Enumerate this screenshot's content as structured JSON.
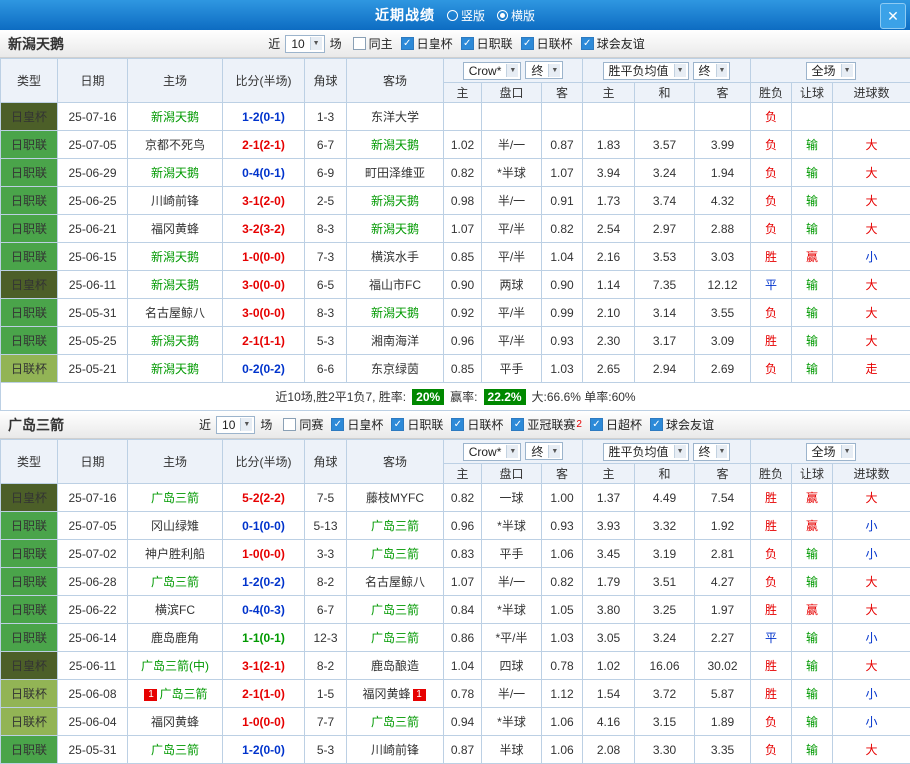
{
  "topbar": {
    "title": "近期战绩",
    "radio_vertical": "竖版",
    "radio_horizontal": "横版",
    "selected_layout": "横版"
  },
  "icons": {
    "dropdown_arrow": "▼",
    "check": "✓",
    "close": "✕"
  },
  "colors": {
    "type_bg": {
      "日皇杯": "#4c5f28",
      "日职联": "#4aa44a",
      "日联杯": "#92b455"
    },
    "score": {
      "home_win": "#e60000",
      "draw": "#009900",
      "away_win": "#0033cc"
    },
    "result": {
      "胜": "#e60000",
      "平": "#0033cc",
      "负": "#e60000",
      "赢": "#e60000",
      "输": "#009900",
      "大": "#e60000",
      "小": "#0033cc",
      "走": "#e60000"
    },
    "focus_team": "#009900",
    "odds_text": "#2b4b9e",
    "summary_badge_bg": "#008800"
  },
  "table_header": {
    "main_cols": [
      "类型",
      "日期",
      "主场",
      "比分(半场)",
      "角球",
      "客场"
    ],
    "group1": {
      "selects": [
        "Crow*",
        "终"
      ],
      "cols": [
        "主",
        "盘口",
        "客"
      ]
    },
    "group2": {
      "selects": [
        "胜平负均值",
        "终"
      ],
      "cols": [
        "主",
        "和",
        "客"
      ]
    },
    "group3": {
      "selects": [
        "全场"
      ],
      "cols": [
        "胜负",
        "让球",
        "进球数"
      ]
    }
  },
  "sections": [
    {
      "team": "新潟天鹅",
      "filter": {
        "prefix": "近",
        "count": "10",
        "suffix": "场",
        "checkboxes": [
          {
            "label": "同主",
            "checked": false
          },
          {
            "label": "日皇杯",
            "checked": true
          },
          {
            "label": "日职联",
            "checked": true
          },
          {
            "label": "日联杯",
            "checked": true
          },
          {
            "label": "球会友谊",
            "checked": true
          }
        ]
      },
      "rows": [
        {
          "type": "日皇杯",
          "date": "25-07-16",
          "home": "新潟天鹅",
          "hf": true,
          "hb": "",
          "score": "1-2(0-1)",
          "sr": "away_win",
          "corner": "1-3",
          "away": "东洋大学",
          "af": false,
          "ab": "",
          "crown": [
            "",
            "",
            ""
          ],
          "avg": [
            "",
            "",
            ""
          ],
          "outcome": [
            "负",
            "",
            ""
          ]
        },
        {
          "type": "日职联",
          "date": "25-07-05",
          "home": "京都不死鸟",
          "hf": false,
          "hb": "",
          "score": "2-1(2-1)",
          "sr": "home_win",
          "corner": "6-7",
          "away": "新潟天鹅",
          "af": true,
          "ab": "",
          "crown": [
            "1.02",
            "半/一",
            "0.87"
          ],
          "avg": [
            "1.83",
            "3.57",
            "3.99"
          ],
          "outcome": [
            "负",
            "输",
            "大"
          ]
        },
        {
          "type": "日职联",
          "date": "25-06-29",
          "home": "新潟天鹅",
          "hf": true,
          "hb": "",
          "score": "0-4(0-1)",
          "sr": "away_win",
          "corner": "6-9",
          "away": "町田泽维亚",
          "af": false,
          "ab": "",
          "crown": [
            "0.82",
            "*半球",
            "1.07"
          ],
          "avg": [
            "3.94",
            "3.24",
            "1.94"
          ],
          "outcome": [
            "负",
            "输",
            "大"
          ]
        },
        {
          "type": "日职联",
          "date": "25-06-25",
          "home": "川崎前锋",
          "hf": false,
          "hb": "",
          "score": "3-1(2-0)",
          "sr": "home_win",
          "corner": "2-5",
          "away": "新潟天鹅",
          "af": true,
          "ab": "",
          "crown": [
            "0.98",
            "半/一",
            "0.91"
          ],
          "avg": [
            "1.73",
            "3.74",
            "4.32"
          ],
          "outcome": [
            "负",
            "输",
            "大"
          ]
        },
        {
          "type": "日职联",
          "date": "25-06-21",
          "home": "福冈黄蜂",
          "hf": false,
          "hb": "",
          "score": "3-2(3-2)",
          "sr": "home_win",
          "corner": "8-3",
          "away": "新潟天鹅",
          "af": true,
          "ab": "",
          "crown": [
            "1.07",
            "平/半",
            "0.82"
          ],
          "avg": [
            "2.54",
            "2.97",
            "2.88"
          ],
          "outcome": [
            "负",
            "输",
            "大"
          ]
        },
        {
          "type": "日职联",
          "date": "25-06-15",
          "home": "新潟天鹅",
          "hf": true,
          "hb": "",
          "score": "1-0(0-0)",
          "sr": "home_win",
          "corner": "7-3",
          "away": "横滨水手",
          "af": false,
          "ab": "",
          "crown": [
            "0.85",
            "平/半",
            "1.04"
          ],
          "avg": [
            "2.16",
            "3.53",
            "3.03"
          ],
          "outcome": [
            "胜",
            "赢",
            "小"
          ]
        },
        {
          "type": "日皇杯",
          "date": "25-06-11",
          "home": "新潟天鹅",
          "hf": true,
          "hb": "",
          "score": "3-0(0-0)",
          "sr": "home_win",
          "corner": "6-5",
          "away": "福山市FC",
          "af": false,
          "ab": "",
          "crown": [
            "0.90",
            "两球",
            "0.90"
          ],
          "avg": [
            "1.14",
            "7.35",
            "12.12"
          ],
          "outcome": [
            "平",
            "输",
            "大"
          ]
        },
        {
          "type": "日职联",
          "date": "25-05-31",
          "home": "名古屋鲸八",
          "hf": false,
          "hb": "",
          "score": "3-0(0-0)",
          "sr": "home_win",
          "corner": "8-3",
          "away": "新潟天鹅",
          "af": true,
          "ab": "",
          "crown": [
            "0.92",
            "平/半",
            "0.99"
          ],
          "avg": [
            "2.10",
            "3.14",
            "3.55"
          ],
          "outcome": [
            "负",
            "输",
            "大"
          ]
        },
        {
          "type": "日职联",
          "date": "25-05-25",
          "home": "新潟天鹅",
          "hf": true,
          "hb": "",
          "score": "2-1(1-1)",
          "sr": "home_win",
          "corner": "5-3",
          "away": "湘南海洋",
          "af": false,
          "ab": "",
          "crown": [
            "0.96",
            "平/半",
            "0.93"
          ],
          "avg": [
            "2.30",
            "3.17",
            "3.09"
          ],
          "outcome": [
            "胜",
            "输",
            "大"
          ]
        },
        {
          "type": "日联杯",
          "date": "25-05-21",
          "home": "新潟天鹅",
          "hf": true,
          "hb": "",
          "score": "0-2(0-2)",
          "sr": "away_win",
          "corner": "6-6",
          "away": "东京绿茵",
          "af": false,
          "ab": "",
          "crown": [
            "0.85",
            "平手",
            "1.03"
          ],
          "avg": [
            "2.65",
            "2.94",
            "2.69"
          ],
          "outcome": [
            "负",
            "输",
            "走"
          ]
        }
      ],
      "summary": [
        {
          "text": "近10场,胜2平1负7, 胜率:",
          "badge": false
        },
        {
          "text": "20%",
          "badge": true
        },
        {
          "text": "赢率:",
          "badge": false
        },
        {
          "text": "22.2%",
          "badge": true
        },
        {
          "text": "大:66.6% 单率:60%",
          "badge": false
        }
      ]
    },
    {
      "team": "广岛三箭",
      "filter": {
        "prefix": "近",
        "count": "10",
        "suffix": "场",
        "checkboxes": [
          {
            "label": "同赛",
            "checked": false
          },
          {
            "label": "日皇杯",
            "checked": true
          },
          {
            "label": "日职联",
            "checked": true
          },
          {
            "label": "日联杯",
            "checked": true
          },
          {
            "label": "亚冠联赛",
            "checked": true,
            "badge": "2"
          },
          {
            "label": "日超杯",
            "checked": true
          },
          {
            "label": "球会友谊",
            "checked": true
          }
        ]
      },
      "rows": [
        {
          "type": "日皇杯",
          "date": "25-07-16",
          "home": "广岛三箭",
          "hf": true,
          "hb": "",
          "score": "5-2(2-2)",
          "sr": "home_win",
          "corner": "7-5",
          "away": "藤枝MYFC",
          "af": false,
          "ab": "",
          "crown": [
            "0.82",
            "一球",
            "1.00"
          ],
          "avg": [
            "1.37",
            "4.49",
            "7.54"
          ],
          "outcome": [
            "胜",
            "赢",
            "大"
          ]
        },
        {
          "type": "日职联",
          "date": "25-07-05",
          "home": "冈山绿雉",
          "hf": false,
          "hb": "",
          "score": "0-1(0-0)",
          "sr": "away_win",
          "corner": "5-13",
          "away": "广岛三箭",
          "af": true,
          "ab": "",
          "crown": [
            "0.96",
            "*半球",
            "0.93"
          ],
          "avg": [
            "3.93",
            "3.32",
            "1.92"
          ],
          "outcome": [
            "胜",
            "赢",
            "小"
          ]
        },
        {
          "type": "日职联",
          "date": "25-07-02",
          "home": "神户胜利船",
          "hf": false,
          "hb": "",
          "score": "1-0(0-0)",
          "sr": "home_win",
          "corner": "3-3",
          "away": "广岛三箭",
          "af": true,
          "ab": "",
          "crown": [
            "0.83",
            "平手",
            "1.06"
          ],
          "avg": [
            "3.45",
            "3.19",
            "2.81"
          ],
          "outcome": [
            "负",
            "输",
            "小"
          ]
        },
        {
          "type": "日职联",
          "date": "25-06-28",
          "home": "广岛三箭",
          "hf": true,
          "hb": "",
          "score": "1-2(0-2)",
          "sr": "away_win",
          "corner": "8-2",
          "away": "名古屋鲸八",
          "af": false,
          "ab": "",
          "crown": [
            "1.07",
            "半/一",
            "0.82"
          ],
          "avg": [
            "1.79",
            "3.51",
            "4.27"
          ],
          "outcome": [
            "负",
            "输",
            "大"
          ]
        },
        {
          "type": "日职联",
          "date": "25-06-22",
          "home": "横滨FC",
          "hf": false,
          "hb": "",
          "score": "0-4(0-3)",
          "sr": "away_win",
          "corner": "6-7",
          "away": "广岛三箭",
          "af": true,
          "ab": "",
          "crown": [
            "0.84",
            "*半球",
            "1.05"
          ],
          "avg": [
            "3.80",
            "3.25",
            "1.97"
          ],
          "outcome": [
            "胜",
            "赢",
            "大"
          ]
        },
        {
          "type": "日职联",
          "date": "25-06-14",
          "home": "鹿岛鹿角",
          "hf": false,
          "hb": "",
          "score": "1-1(0-1)",
          "sr": "draw",
          "corner": "12-3",
          "away": "广岛三箭",
          "af": true,
          "ab": "",
          "crown": [
            "0.86",
            "*平/半",
            "1.03"
          ],
          "avg": [
            "3.05",
            "3.24",
            "2.27"
          ],
          "outcome": [
            "平",
            "输",
            "小"
          ]
        },
        {
          "type": "日皇杯",
          "date": "25-06-11",
          "home": "广岛三箭(中)",
          "hf": true,
          "hb": "",
          "score": "3-1(2-1)",
          "sr": "home_win",
          "corner": "8-2",
          "away": "鹿岛酿造",
          "af": false,
          "ab": "",
          "crown": [
            "1.04",
            "四球",
            "0.78"
          ],
          "avg": [
            "1.02",
            "16.06",
            "30.02"
          ],
          "outcome": [
            "胜",
            "输",
            "大"
          ]
        },
        {
          "type": "日联杯",
          "date": "25-06-08",
          "home": "广岛三箭",
          "hf": true,
          "hb": "1",
          "score": "2-1(1-0)",
          "sr": "home_win",
          "corner": "1-5",
          "away": "福冈黄蜂",
          "af": false,
          "ab": "1",
          "crown": [
            "0.78",
            "半/一",
            "1.12"
          ],
          "avg": [
            "1.54",
            "3.72",
            "5.87"
          ],
          "outcome": [
            "胜",
            "输",
            "小"
          ]
        },
        {
          "type": "日联杯",
          "date": "25-06-04",
          "home": "福冈黄蜂",
          "hf": false,
          "hb": "",
          "score": "1-0(0-0)",
          "sr": "home_win",
          "corner": "7-7",
          "away": "广岛三箭",
          "af": true,
          "ab": "",
          "crown": [
            "0.94",
            "*半球",
            "1.06"
          ],
          "avg": [
            "4.16",
            "3.15",
            "1.89"
          ],
          "outcome": [
            "负",
            "输",
            "小"
          ]
        },
        {
          "type": "日职联",
          "date": "25-05-31",
          "home": "广岛三箭",
          "hf": true,
          "hb": "",
          "score": "1-2(0-0)",
          "sr": "away_win",
          "corner": "5-3",
          "away": "川崎前锋",
          "af": false,
          "ab": "",
          "crown": [
            "0.87",
            "半球",
            "1.06"
          ],
          "avg": [
            "2.08",
            "3.30",
            "3.35"
          ],
          "outcome": [
            "负",
            "输",
            "大"
          ]
        }
      ],
      "summary": null
    }
  ]
}
